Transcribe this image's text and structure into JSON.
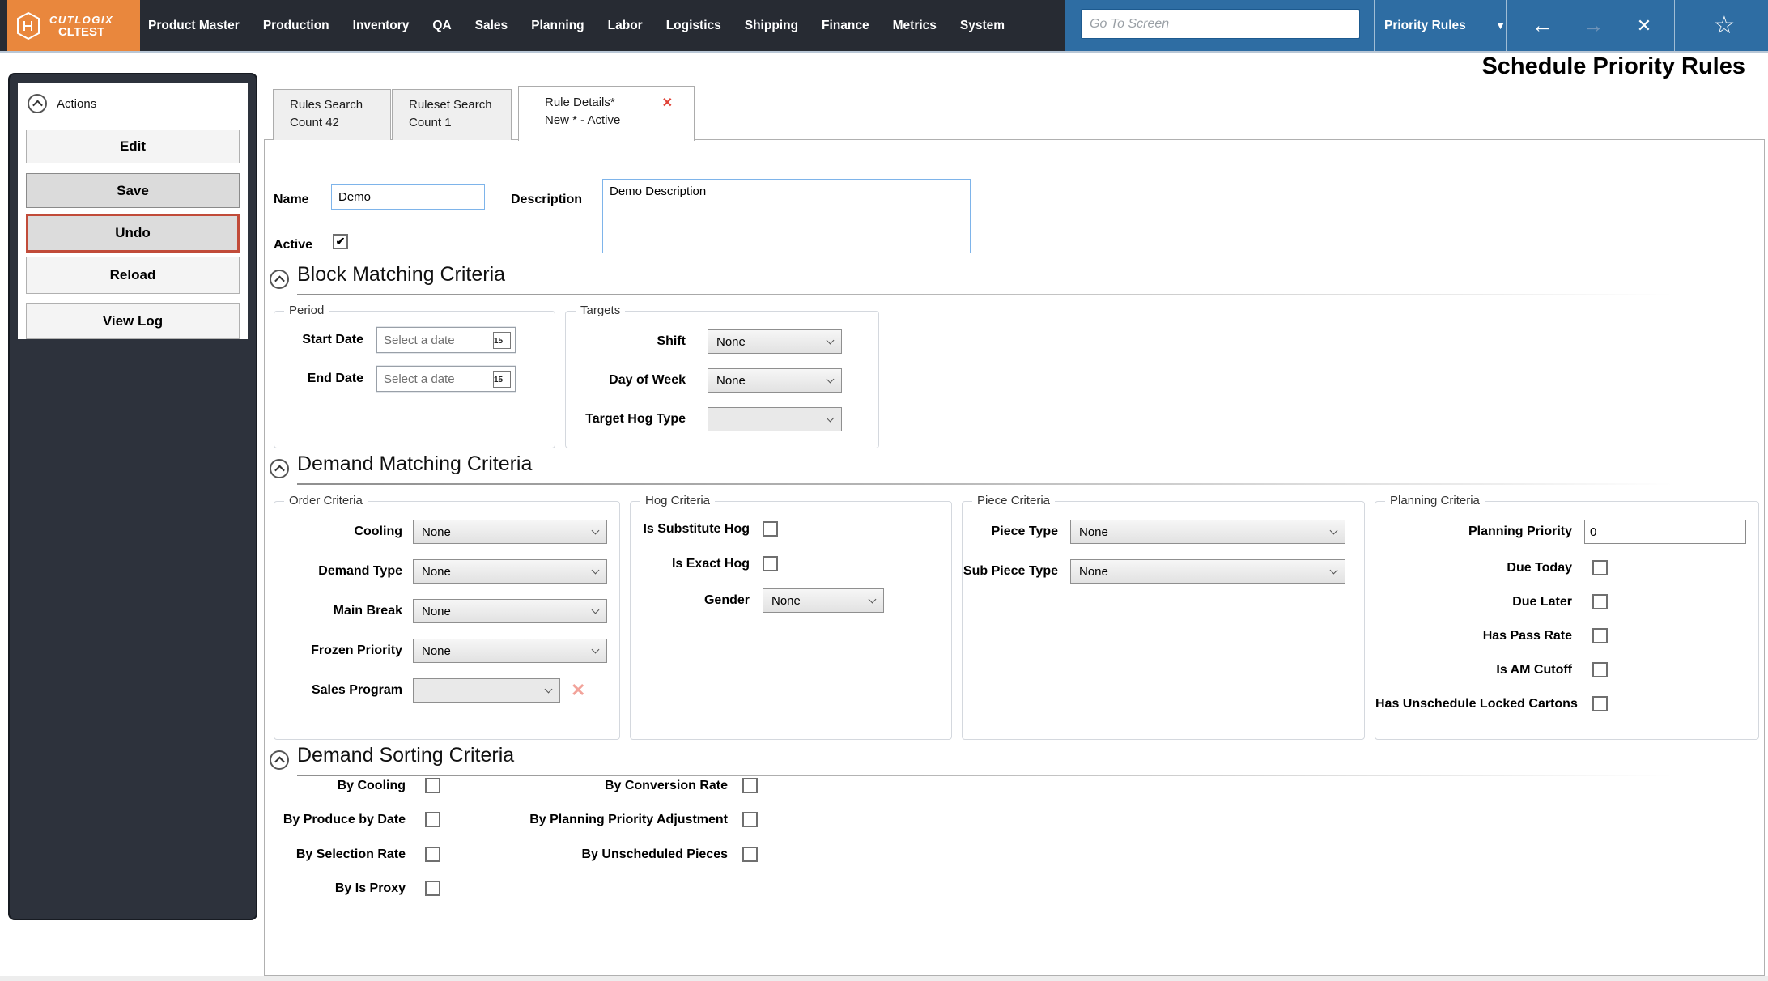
{
  "topbar": {
    "brand": "CUTLOGIX",
    "environment": "CLTEST",
    "menu": [
      "Product Master",
      "Production",
      "Inventory",
      "QA",
      "Sales",
      "Planning",
      "Labor",
      "Logistics",
      "Shipping",
      "Finance",
      "Metrics",
      "System"
    ],
    "goto_placeholder": "Go To Screen",
    "screen_selector": "Priority Rules"
  },
  "icons": {
    "checkmark": "✔",
    "back_arrow": "←",
    "forward_arrow": "→",
    "close": "✕",
    "favorite_star": "☆",
    "dropdown_caret": "▼",
    "tab_close": "✕",
    "clear_x": "✕"
  },
  "page_title": "Schedule Priority Rules",
  "actions_panel": {
    "title": "Actions",
    "buttons": [
      "Edit",
      "Save",
      "Undo",
      "Reload",
      "View Log"
    ]
  },
  "tabs": [
    {
      "line1": "Rules Search",
      "line2": "Count 42"
    },
    {
      "line1": "Ruleset Search",
      "line2": "Count 1"
    },
    {
      "line1": "Rule Details*",
      "line2": "New * - Active"
    }
  ],
  "form": {
    "name_label": "Name",
    "name_value": "Demo",
    "description_label": "Description",
    "description_value": "Demo Description",
    "active_label": "Active",
    "active_checked": true
  },
  "block_matching": {
    "title": "Block Matching Criteria",
    "period": {
      "legend": "Period",
      "start_date_label": "Start Date",
      "end_date_label": "End Date",
      "date_placeholder": "Select a date",
      "calendar_day": "15"
    },
    "targets": {
      "legend": "Targets",
      "shift_label": "Shift",
      "shift_value": "None",
      "day_of_week_label": "Day of Week",
      "day_of_week_value": "None",
      "target_hog_type_label": "Target Hog Type",
      "target_hog_type_value": ""
    }
  },
  "demand_matching": {
    "title": "Demand Matching Criteria",
    "order": {
      "legend": "Order Criteria",
      "cooling_label": "Cooling",
      "cooling_value": "None",
      "demand_type_label": "Demand Type",
      "demand_type_value": "None",
      "main_break_label": "Main Break",
      "main_break_value": "None",
      "frozen_priority_label": "Frozen Priority",
      "frozen_priority_value": "None",
      "sales_program_label": "Sales Program",
      "sales_program_value": ""
    },
    "hog": {
      "legend": "Hog Criteria",
      "is_substitute_hog_label": "Is Substitute Hog",
      "is_exact_hog_label": "Is Exact Hog",
      "gender_label": "Gender",
      "gender_value": "None"
    },
    "piece": {
      "legend": "Piece Criteria",
      "piece_type_label": "Piece Type",
      "piece_type_value": "None",
      "sub_piece_type_label": "Sub Piece Type",
      "sub_piece_type_value": "None"
    },
    "planning": {
      "legend": "Planning Criteria",
      "planning_priority_label": "Planning Priority",
      "planning_priority_value": "0",
      "due_today_label": "Due Today",
      "due_later_label": "Due Later",
      "has_pass_rate_label": "Has Pass Rate",
      "is_am_cutoff_label": "Is AM Cutoff",
      "has_unschedule_locked_cartons_label": "Has Unschedule Locked Cartons"
    }
  },
  "demand_sorting": {
    "title": "Demand Sorting Criteria",
    "col1": [
      "By Cooling",
      "By Produce by Date",
      "By Selection Rate",
      "By Is Proxy"
    ],
    "col2": [
      "By Conversion Rate",
      "By Planning Priority Adjustment",
      "By Unscheduled Pieces"
    ]
  },
  "colors": {
    "brand_orange": "#E9873D",
    "topbar_dark": "#272B33",
    "accent_blue": "#2E6DA3",
    "sidebar_dark": "#2D323C",
    "undo_border_red": "#C14B39",
    "tab_close_red": "#E04338",
    "clear_x_pink": "#F2A39A",
    "input_focus_blue": "#7EB4EA"
  }
}
